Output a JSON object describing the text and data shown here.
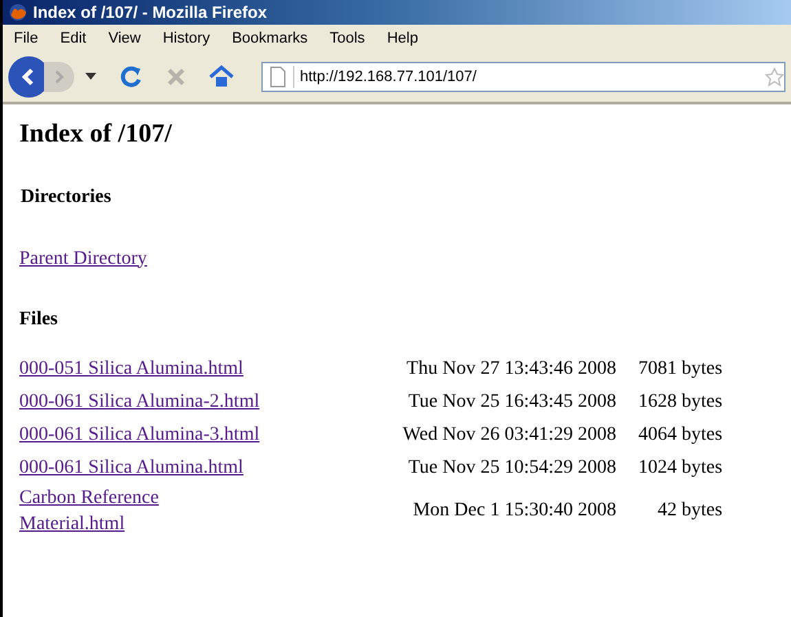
{
  "window": {
    "title": "Index of /107/ - Mozilla Firefox"
  },
  "menu": [
    "File",
    "Edit",
    "View",
    "History",
    "Bookmarks",
    "Tools",
    "Help"
  ],
  "address_bar": {
    "value": "http://192.168.77.101/107/"
  },
  "page": {
    "heading": "Index of /107/",
    "directories_heading": "Directories",
    "directories": [
      "Parent Directory"
    ],
    "files_heading": "Files",
    "files": [
      {
        "name": "000-051 Silica Alumina.html",
        "date": "Thu Nov 27 13:43:46 2008",
        "size": "7081 bytes"
      },
      {
        "name": "000-061 Silica Alumina-2.html",
        "date": "Tue Nov 25 16:43:45 2008",
        "size": "1628 bytes"
      },
      {
        "name": "000-061 Silica Alumina-3.html",
        "date": "Wed Nov 26 03:41:29 2008",
        "size": "4064 bytes"
      },
      {
        "name": "000-061 Silica Alumina.html",
        "date": "Tue Nov 25 10:54:29 2008",
        "size": "1024 bytes"
      },
      {
        "name": "Carbon Reference Material.html",
        "date": "Mon Dec 1 15:30:40 2008",
        "size": "42 bytes"
      }
    ]
  }
}
